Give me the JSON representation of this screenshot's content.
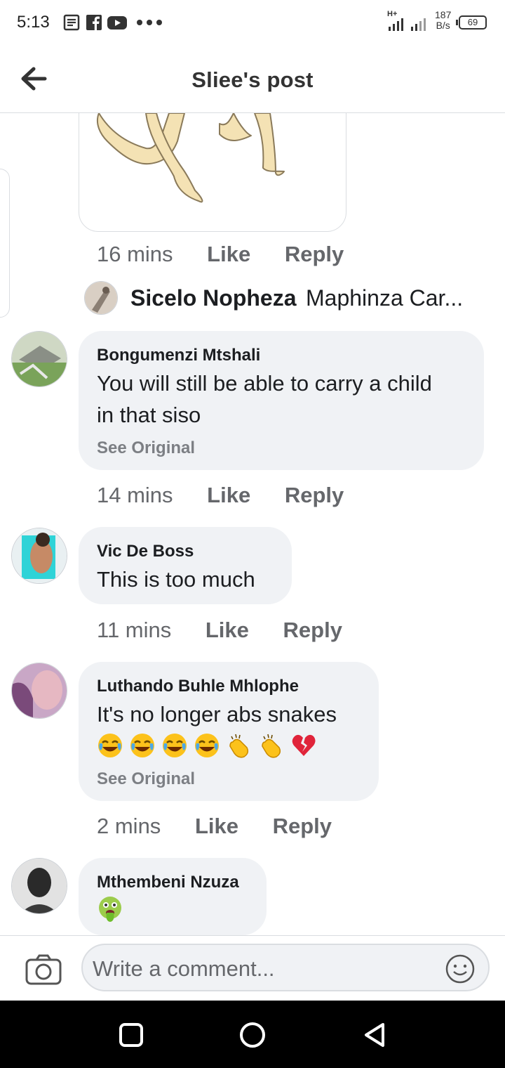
{
  "status": {
    "time": "5:13",
    "signal_label": "H+",
    "speed_value": "187",
    "speed_unit": "B/s",
    "battery": "69",
    "notif_icons": [
      "news-icon",
      "facebook-icon",
      "youtube-icon",
      "more-dots-icon"
    ]
  },
  "header": {
    "title": "Sliee's post"
  },
  "post_meta": {
    "time": "16 mins",
    "like": "Like",
    "reply": "Reply"
  },
  "reply_preview": {
    "name": "Sicelo Nopheza",
    "text": "Maphinza Car..."
  },
  "comments": [
    {
      "name": "Bongumenzi Mtshali",
      "lines": [
        "You will still be able to carry a child",
        "in that siso"
      ],
      "see_original": "See Original",
      "time": "14 mins",
      "like": "Like",
      "reply": "Reply"
    },
    {
      "name": "Vic De Boss",
      "lines": [
        "This is too much"
      ],
      "time": "11 mins",
      "like": "Like",
      "reply": "Reply"
    },
    {
      "name": "Luthando Buhle Mhlophe",
      "lines": [
        "It's no longer abs snakes"
      ],
      "emojis": [
        "joy",
        "joy",
        "joy",
        "joy",
        "clap",
        "clap",
        "broken-heart"
      ],
      "see_original": "See Original",
      "time": "2 mins",
      "like": "Like",
      "reply": "Reply"
    },
    {
      "name": "Mthembeni Nzuza",
      "emojis": [
        "vomit"
      ]
    }
  ],
  "composer": {
    "placeholder": "Write a comment..."
  },
  "colors": {
    "bubble": "#f0f2f5",
    "meta": "#65676b",
    "divider": "#dadde1"
  }
}
